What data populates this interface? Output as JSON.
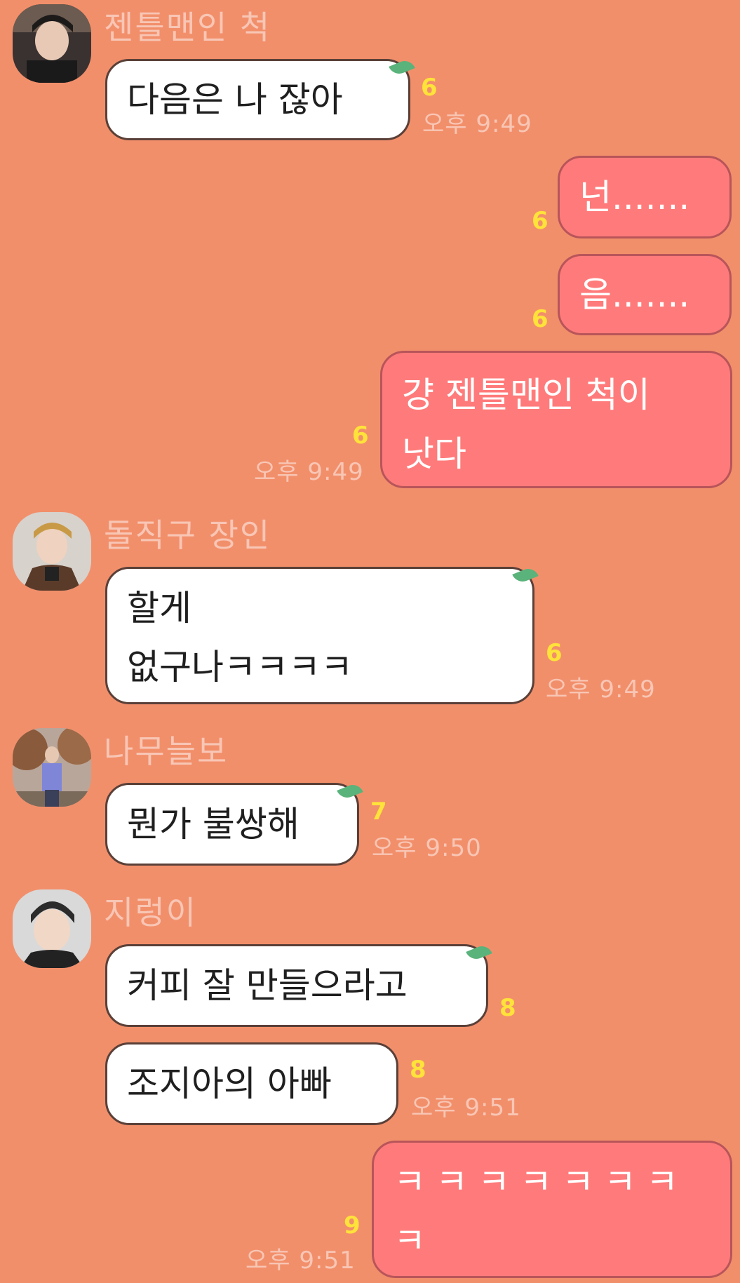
{
  "messages": [
    {
      "sender": "젠틀맨인 척",
      "text": "다음은 나 잖아",
      "count": "6",
      "time": "오후 9:49"
    },
    {
      "text": "넌.......",
      "count": "6"
    },
    {
      "text": "음.......",
      "count": "6"
    },
    {
      "line1": "걍 젠틀맨인 척이",
      "line2": "낫다",
      "count": "6",
      "time": "오후 9:49"
    },
    {
      "sender": "돌직구 장인",
      "line1": "할게",
      "line2": "없구나ㅋㅋㅋㅋ",
      "count": "6",
      "time": "오후 9:49"
    },
    {
      "sender": "나무늘보",
      "text": "뭔가 불쌍해",
      "count": "7",
      "time": "오후 9:50"
    },
    {
      "sender": "지렁이",
      "text": "커피 잘 만들으라고",
      "count": "8"
    },
    {
      "text": "조지아의 아빠",
      "count": "8",
      "time": "오후 9:51"
    },
    {
      "line1": "ㅋㅋㅋㅋㅋㅋㅋ",
      "line2": "ㅋ",
      "count": "9",
      "time": "오후 9:51"
    }
  ],
  "colors": {
    "background": "#F28F6B",
    "incoming_bubble": "#FFFFFF",
    "outgoing_bubble": "#FF7B7B",
    "unread_count": "#FFE23A",
    "meta_text": "#F8C6B5",
    "leaf": "#59B37A"
  },
  "icons": {
    "bubble_tail": "leaf-icon",
    "avatar": "profile-photo"
  }
}
